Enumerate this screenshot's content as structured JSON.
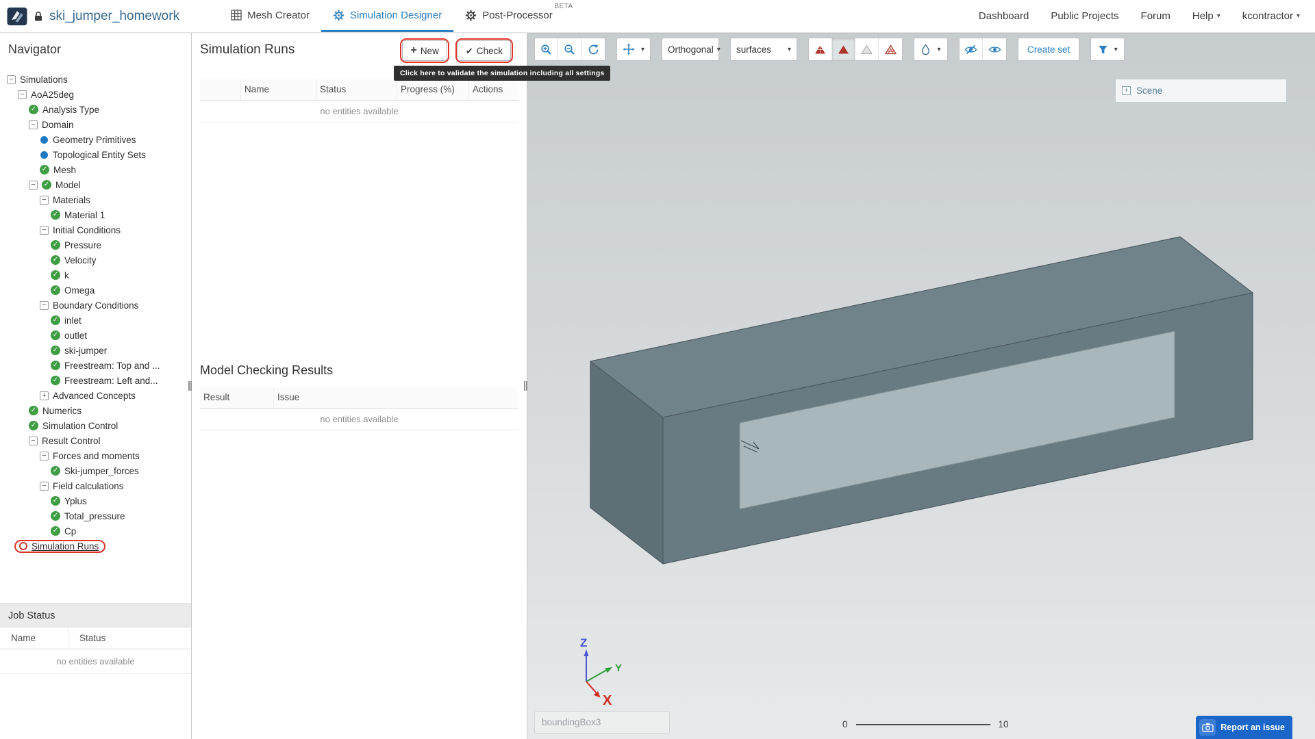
{
  "colors": {
    "accent_blue": "#2d7fc1",
    "title_blue": "#38688f",
    "success_green": "#3f9d44",
    "entity_blue": "#1d79c0",
    "annotation_red": "#e0342a",
    "report_blue": "#1b66c9"
  },
  "topbar": {
    "project_title": "ski_jumper_homework",
    "tabs": [
      {
        "label": "Mesh Creator",
        "icon": "grid-icon",
        "active": false
      },
      {
        "label": "Simulation Designer",
        "icon": "gear-icon",
        "active": true
      },
      {
        "label": "Post-Processor",
        "icon": "gear-icon",
        "active": false,
        "badge": "BETA"
      }
    ],
    "nav_links": [
      {
        "label": "Dashboard"
      },
      {
        "label": "Public Projects"
      },
      {
        "label": "Forum"
      },
      {
        "label": "Help",
        "caret": true
      },
      {
        "label": "kcontractor",
        "caret": true
      }
    ]
  },
  "navigator": {
    "title": "Navigator",
    "tree": [
      {
        "label": "Simulations",
        "level": 0,
        "toggle": "minus",
        "icon": "none"
      },
      {
        "label": "AoA25deg",
        "level": 1,
        "toggle": "minus",
        "icon": "none"
      },
      {
        "label": "Analysis Type",
        "level": 2,
        "toggle": "none",
        "icon": "check"
      },
      {
        "label": "Domain",
        "level": 2,
        "toggle": "minus",
        "icon": "none"
      },
      {
        "label": "Geometry Primitives",
        "level": 3,
        "toggle": "none",
        "icon": "dot"
      },
      {
        "label": "Topological Entity Sets",
        "level": 3,
        "toggle": "none",
        "icon": "dot"
      },
      {
        "label": "Mesh",
        "level": 3,
        "toggle": "none",
        "icon": "check"
      },
      {
        "label": "Model",
        "level": 2,
        "toggle": "minus",
        "icon": "check"
      },
      {
        "label": "Materials",
        "level": 3,
        "toggle": "minus",
        "icon": "none"
      },
      {
        "label": "Material 1",
        "level": 4,
        "toggle": "none",
        "icon": "check"
      },
      {
        "label": "Initial Conditions",
        "level": 3,
        "toggle": "minus",
        "icon": "none"
      },
      {
        "label": "Pressure",
        "level": 4,
        "toggle": "none",
        "icon": "check"
      },
      {
        "label": "Velocity",
        "level": 4,
        "toggle": "none",
        "icon": "check"
      },
      {
        "label": "k",
        "level": 4,
        "toggle": "none",
        "icon": "check"
      },
      {
        "label": "Omega",
        "level": 4,
        "toggle": "none",
        "icon": "check"
      },
      {
        "label": "Boundary Conditions",
        "level": 3,
        "toggle": "minus",
        "icon": "none"
      },
      {
        "label": "inlet",
        "level": 4,
        "toggle": "none",
        "icon": "check"
      },
      {
        "label": "outlet",
        "level": 4,
        "toggle": "none",
        "icon": "check"
      },
      {
        "label": "ski-jumper",
        "level": 4,
        "toggle": "none",
        "icon": "check"
      },
      {
        "label": "Freestream: Top and ...",
        "level": 4,
        "toggle": "none",
        "icon": "check"
      },
      {
        "label": "Freestream: Left and...",
        "level": 4,
        "toggle": "none",
        "icon": "check"
      },
      {
        "label": "Advanced Concepts",
        "level": 3,
        "toggle": "plus",
        "icon": "none"
      },
      {
        "label": "Numerics",
        "level": 2,
        "toggle": "none",
        "icon": "check"
      },
      {
        "label": "Simulation Control",
        "level": 2,
        "toggle": "none",
        "icon": "check"
      },
      {
        "label": "Result Control",
        "level": 2,
        "toggle": "minus",
        "icon": "none"
      },
      {
        "label": "Forces and moments",
        "level": 3,
        "toggle": "minus",
        "icon": "none"
      },
      {
        "label": "Ski-jumper_forces",
        "level": 4,
        "toggle": "none",
        "icon": "check"
      },
      {
        "label": "Field calculations",
        "level": 3,
        "toggle": "minus",
        "icon": "none"
      },
      {
        "label": "Yplus",
        "level": 4,
        "toggle": "none",
        "icon": "check"
      },
      {
        "label": "Total_pressure",
        "level": 4,
        "toggle": "none",
        "icon": "check"
      },
      {
        "label": "Cp",
        "level": 4,
        "toggle": "none",
        "icon": "check"
      },
      {
        "label": "Simulation Runs",
        "level": 1,
        "toggle": "none",
        "icon": "pending",
        "annotated": true,
        "underline": true
      }
    ],
    "job_status": {
      "title": "Job Status",
      "columns": [
        "Name",
        "Status"
      ],
      "empty_text": "no entities available"
    }
  },
  "runs_panel": {
    "title": "Simulation Runs",
    "buttons": {
      "new": "New",
      "check": "Check"
    },
    "tooltip": "Click here to validate the simulation including all settings",
    "runs_table": {
      "columns": [
        "",
        "Name",
        "Status",
        "Progress (%)",
        "Actions"
      ],
      "empty_text": "no entities available"
    },
    "model_checking": {
      "title": "Model Checking Results",
      "columns": [
        "Result",
        "Issue"
      ],
      "empty_text": "no entities available"
    }
  },
  "viewport": {
    "toolbar": {
      "projection_select": "Orthogonal",
      "render_select": "surfaces",
      "create_set_label": "Create set"
    },
    "scene_panel": {
      "label": "Scene"
    },
    "selection_label": "boundingBox3",
    "scale_bar": {
      "min": "0",
      "max": "10"
    },
    "axes": {
      "x": "X",
      "y": "Y",
      "z": "Z"
    },
    "report_issue_label": "Report an issue"
  }
}
